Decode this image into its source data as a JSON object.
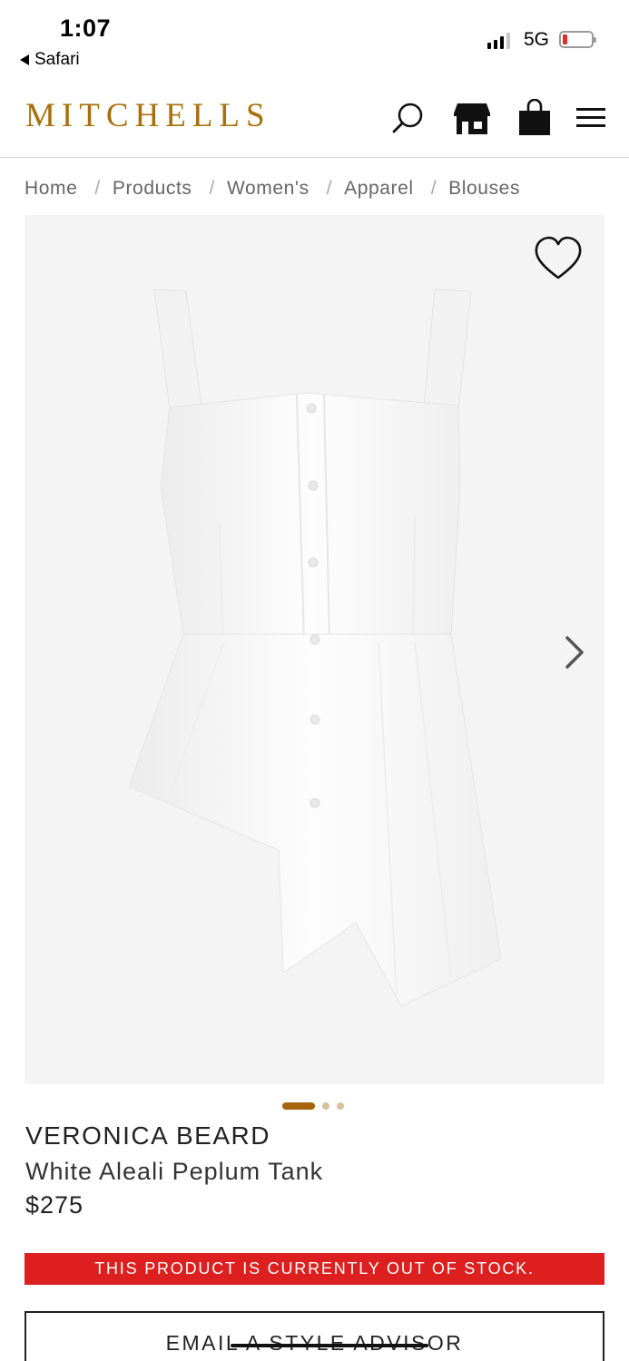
{
  "status_bar": {
    "time": "1:07",
    "back_app": "Safari",
    "network": "5G",
    "battery_level": 0.1,
    "battery_color": "#e0302a"
  },
  "header": {
    "logo": "MITCHELLS",
    "brand_color": "#a8700c",
    "icons": [
      "search-icon",
      "store-icon",
      "shopping-bag-icon",
      "menu-icon"
    ]
  },
  "breadcrumb": [
    {
      "label": "Home"
    },
    {
      "label": "Products"
    },
    {
      "label": "Women's"
    },
    {
      "label": "Apparel"
    },
    {
      "label": "Blouses"
    }
  ],
  "gallery": {
    "image_alt": "White Aleali Peplum Tank",
    "total_images": 3,
    "current_index": 1,
    "icons": [
      "heart-icon",
      "chevron-right-icon"
    ]
  },
  "product": {
    "brand": "VERONICA BEARD",
    "name": "White Aleali Peplum Tank",
    "price": "$275"
  },
  "stock_notice": "THIS PRODUCT IS CURRENTLY OUT OF STOCK.",
  "advisor_button": "EMAIL A STYLE ADVISOR"
}
